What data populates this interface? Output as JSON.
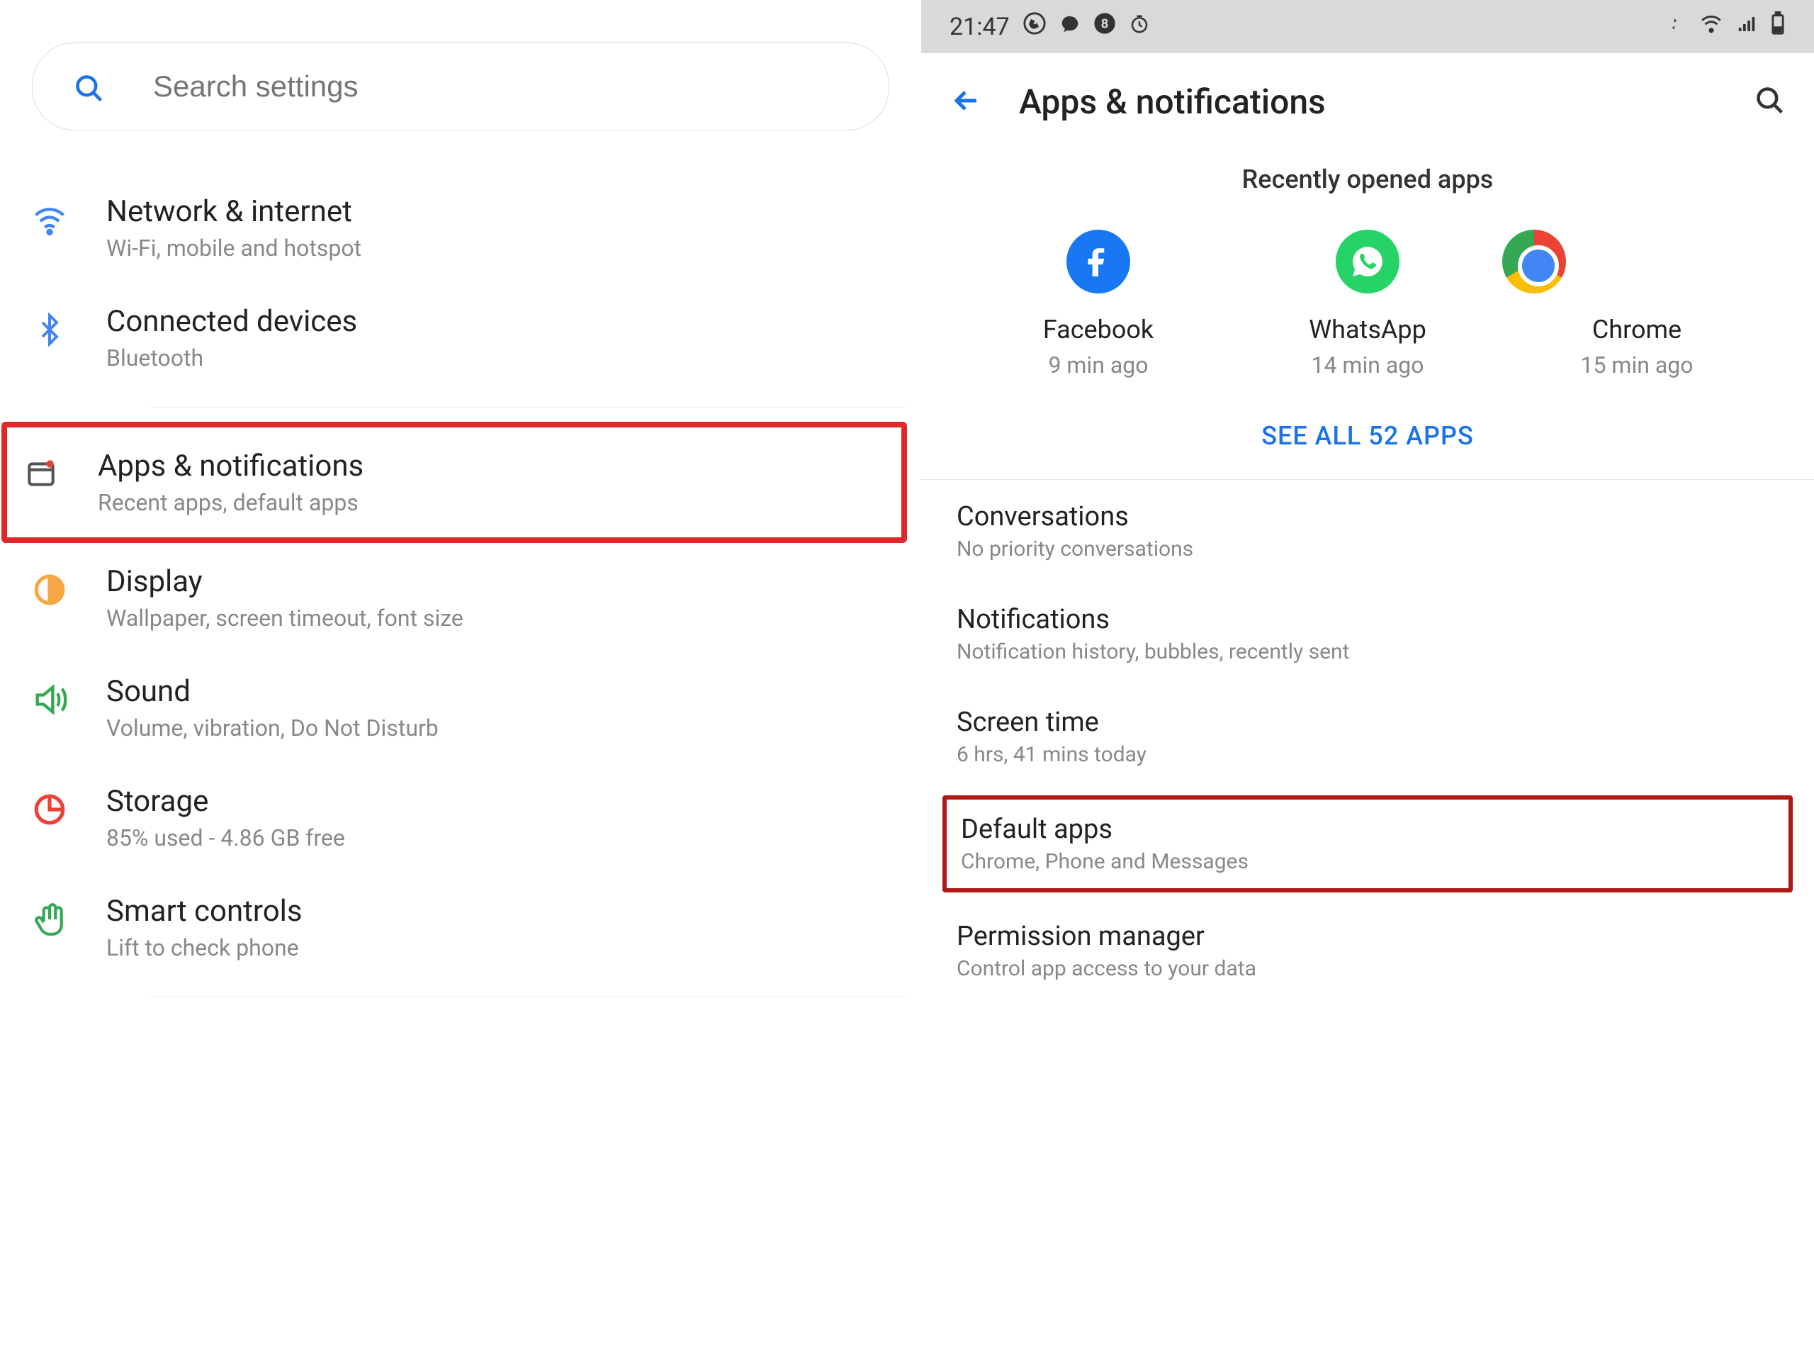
{
  "left": {
    "search_placeholder": "Search settings",
    "items": [
      {
        "title": "Network & internet",
        "sub": "Wi-Fi, mobile and hotspot"
      },
      {
        "title": "Connected devices",
        "sub": "Bluetooth"
      },
      {
        "title": "Apps & notifications",
        "sub": "Recent apps, default apps"
      },
      {
        "title": "Display",
        "sub": "Wallpaper, screen timeout, font size"
      },
      {
        "title": "Sound",
        "sub": "Volume, vibration, Do Not Disturb"
      },
      {
        "title": "Storage",
        "sub": "85% used - 4.86 GB free"
      },
      {
        "title": "Smart controls",
        "sub": "Lift to check phone"
      }
    ]
  },
  "right": {
    "status_time": "21:47",
    "header_title": "Apps & notifications",
    "recently_header": "Recently opened apps",
    "recent_apps": [
      {
        "name": "Facebook",
        "time": "9 min ago"
      },
      {
        "name": "WhatsApp",
        "time": "14 min ago"
      },
      {
        "name": "Chrome",
        "time": "15 min ago"
      }
    ],
    "see_all": "SEE ALL 52 APPS",
    "items": [
      {
        "title": "Conversations",
        "sub": "No priority conversations"
      },
      {
        "title": "Notifications",
        "sub": "Notification history, bubbles, recently sent"
      },
      {
        "title": "Screen time",
        "sub": "6 hrs, 41 mins today"
      },
      {
        "title": "Default apps",
        "sub": "Chrome, Phone and Messages"
      },
      {
        "title": "Permission manager",
        "sub": "Control app access to your data"
      }
    ]
  }
}
